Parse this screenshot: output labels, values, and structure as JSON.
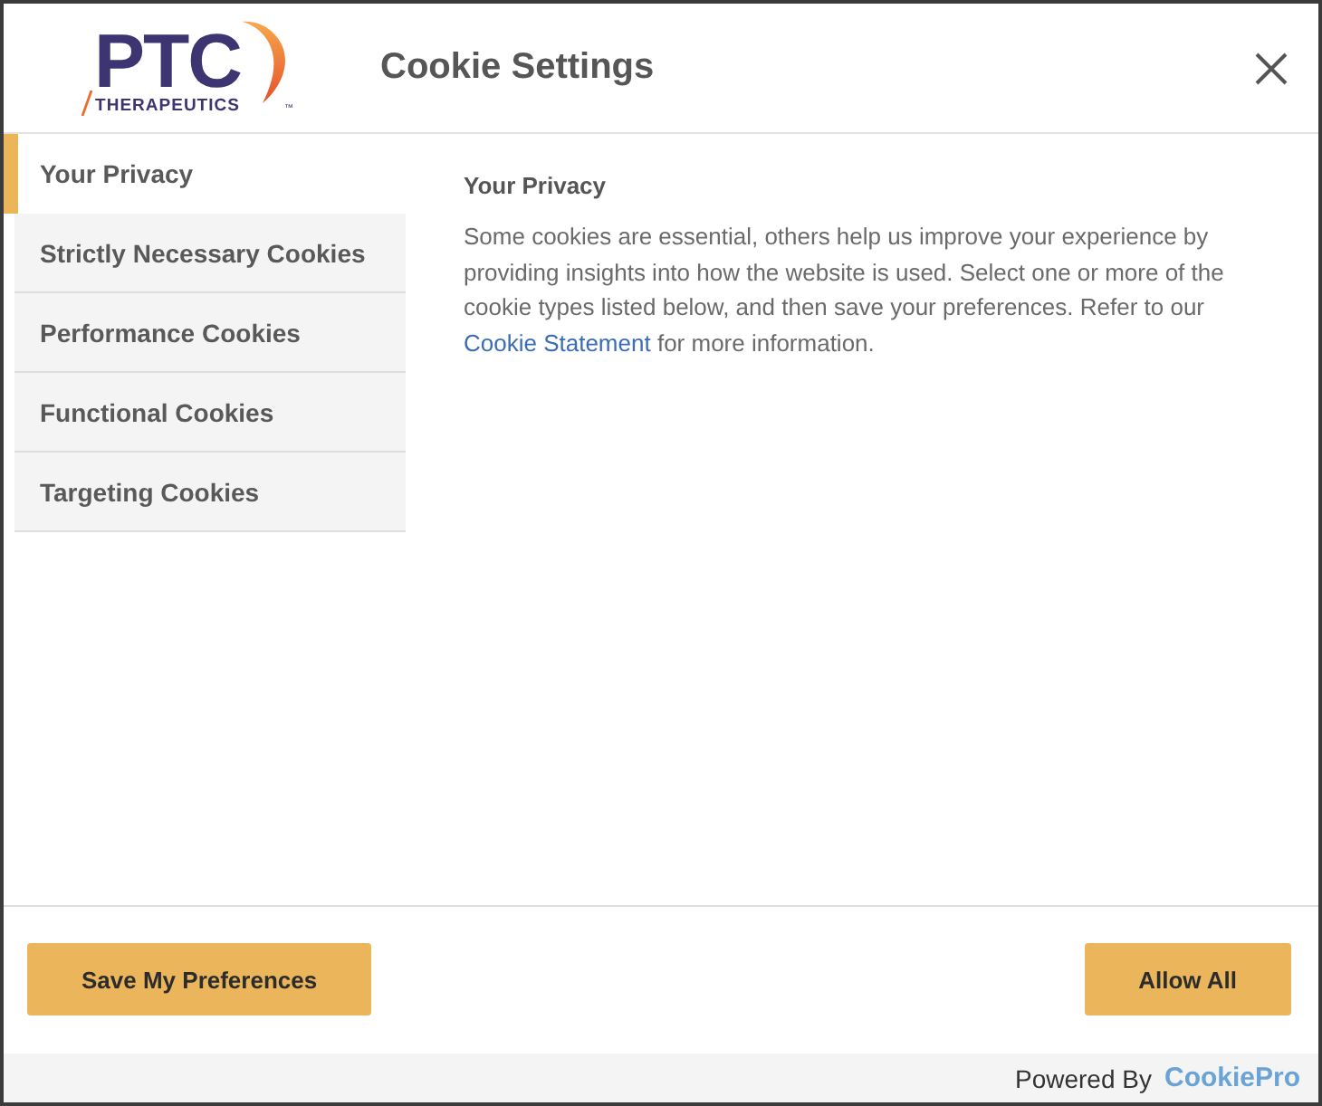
{
  "header": {
    "logo": {
      "wordmark": "PTC",
      "subtitle": "THERAPEUTICS",
      "trademark": "™"
    },
    "title": "Cookie Settings"
  },
  "sidebar": {
    "items": [
      {
        "label": "Your Privacy",
        "selected": true
      },
      {
        "label": "Strictly Necessary Cookies",
        "selected": false
      },
      {
        "label": "Performance Cookies",
        "selected": false
      },
      {
        "label": "Functional Cookies",
        "selected": false
      },
      {
        "label": "Targeting Cookies",
        "selected": false
      }
    ]
  },
  "content": {
    "heading": "Your Privacy",
    "text_before_link": "Some cookies are essential, others help us improve your experience by providing insights into how the website is used. Select one or more of the cookie types listed below, and then save your preferences. Refer to our ",
    "link": "Cookie Statement",
    "text_after_link": " for more information."
  },
  "footer": {
    "buttons": [
      "Save My Preferences",
      "Allow All"
    ]
  },
  "powered_by": {
    "text": "Powered By",
    "brand": "CookiePro"
  }
}
